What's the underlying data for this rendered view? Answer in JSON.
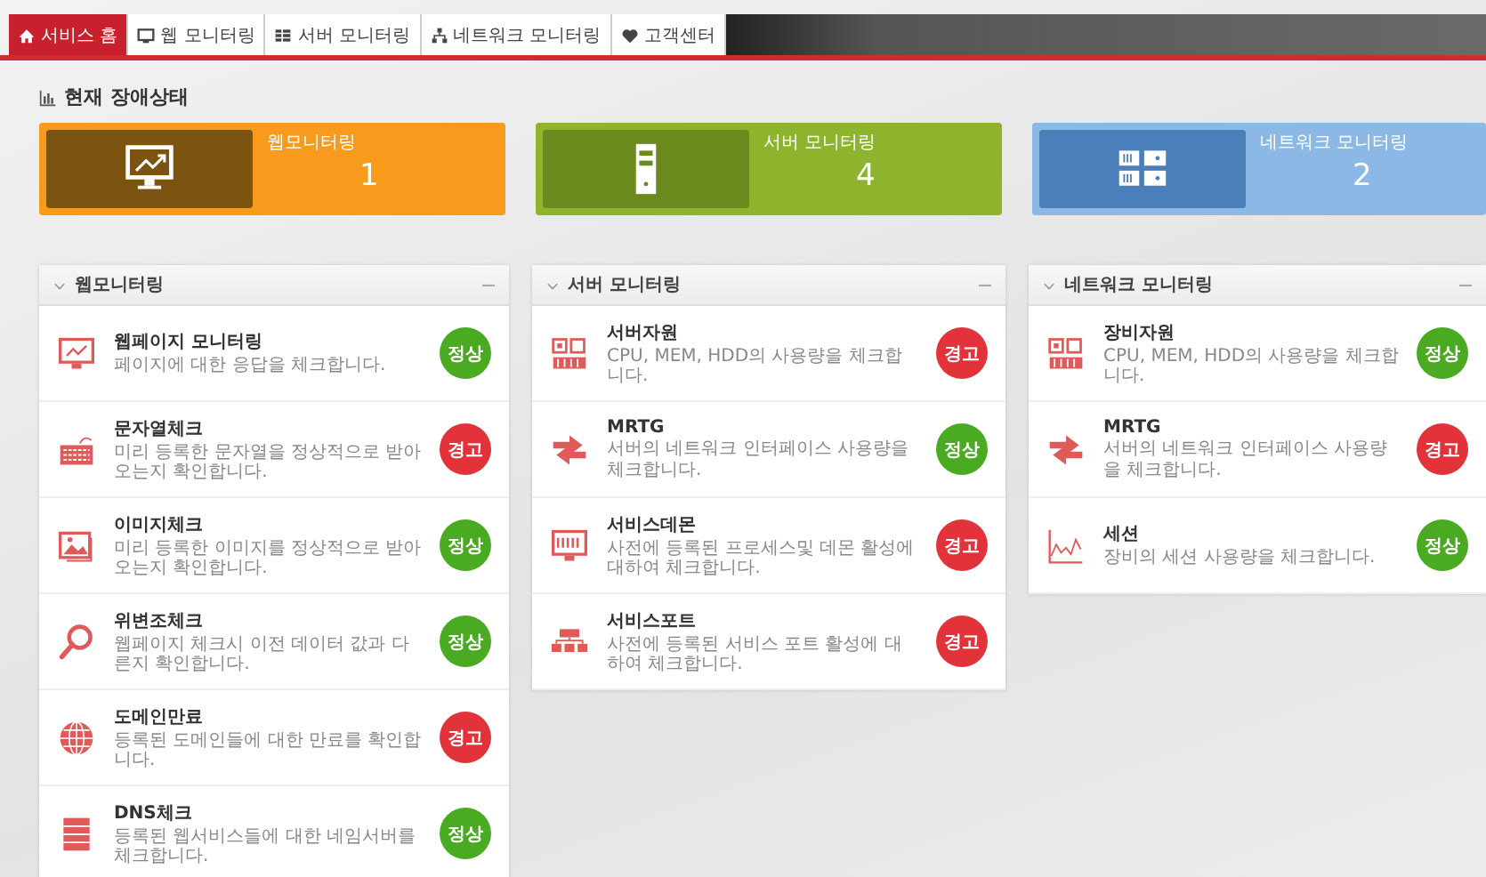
{
  "tabs": [
    {
      "label": "서비스 홈",
      "selected": true
    },
    {
      "label": "웹 모니터링",
      "selected": false
    },
    {
      "label": "서버 모니터링",
      "selected": false
    },
    {
      "label": "네트워크 모니터링",
      "selected": false
    },
    {
      "label": "고객센터",
      "selected": false
    }
  ],
  "status_title": "현재 장애상태",
  "summary_cards": [
    {
      "title": "웹모니터링",
      "count": "1",
      "kind": "web",
      "color": "#f89a1c"
    },
    {
      "title": "서버 모니터링",
      "count": "4",
      "kind": "server",
      "color": "#8db42c"
    },
    {
      "title": "네트워크 모니터링",
      "count": "2",
      "kind": "network",
      "color": "#8bb8e4"
    }
  ],
  "panels": [
    {
      "title": "웹모니터링",
      "items": [
        {
          "kind": "webpage",
          "title": "웹페이지 모니터링",
          "description": "페이지에 대한 응답을 체크합니다.",
          "warning": false,
          "status_label": "정상"
        },
        {
          "kind": "keyboard",
          "title": "문자열체크",
          "description": "미리 등록한 문자열을 정상적으로 받아오는지 확인합니다.",
          "warning": true,
          "status_label": "경고"
        },
        {
          "kind": "image",
          "title": "이미지체크",
          "description": "미리 등록한 이미지를 정상적으로 받아오는지 확인합니다.",
          "warning": false,
          "status_label": "정상"
        },
        {
          "kind": "search",
          "title": "위변조체크",
          "description": "웹페이지 체크시 이전 데이터 값과 다른지 확인합니다.",
          "warning": false,
          "status_label": "정상"
        },
        {
          "kind": "globe",
          "title": "도메인만료",
          "description": "등록된 도메인들에 대한 만료를 확인합니다.",
          "warning": true,
          "status_label": "경고"
        },
        {
          "kind": "dns",
          "title": "DNS체크",
          "description": "등록된 웹서비스들에 대한 네임서버를 체크합니다.",
          "warning": false,
          "status_label": "정상"
        }
      ]
    },
    {
      "title": "서버 모니터링",
      "items": [
        {
          "kind": "hardware",
          "title": "서버자원",
          "description": "CPU, MEM, HDD의 사용량을 체크합니다.",
          "warning": true,
          "status_label": "경고"
        },
        {
          "kind": "transfer",
          "title": "MRTG",
          "description": "서버의 네트워크 인터페이스 사용량을 체크합니다.",
          "warning": false,
          "status_label": "정상"
        },
        {
          "kind": "daemon",
          "title": "서비스데몬",
          "description": "사전에 등록된 프로세스및 데몬 활성에 대하여 체크합니다.",
          "warning": true,
          "status_label": "경고"
        },
        {
          "kind": "ports",
          "title": "서비스포트",
          "description": "사전에 등록된 서비스 포트 활성에 대하여 체크합니다.",
          "warning": true,
          "status_label": "경고"
        }
      ]
    },
    {
      "title": "네트워크 모니터링",
      "items": [
        {
          "kind": "hardware",
          "title": "장비자원",
          "description": "CPU, MEM, HDD의 사용량을 체크합니다.",
          "warning": false,
          "status_label": "정상"
        },
        {
          "kind": "transfer",
          "title": "MRTG",
          "description": "서버의 네트워크 인터페이스 사용량을 체크합니다.",
          "warning": true,
          "status_label": "경고"
        },
        {
          "kind": "chart",
          "title": "세션",
          "description": "장비의 세션 사용량을 체크합니다.",
          "warning": false,
          "status_label": "정상"
        }
      ]
    }
  ]
}
